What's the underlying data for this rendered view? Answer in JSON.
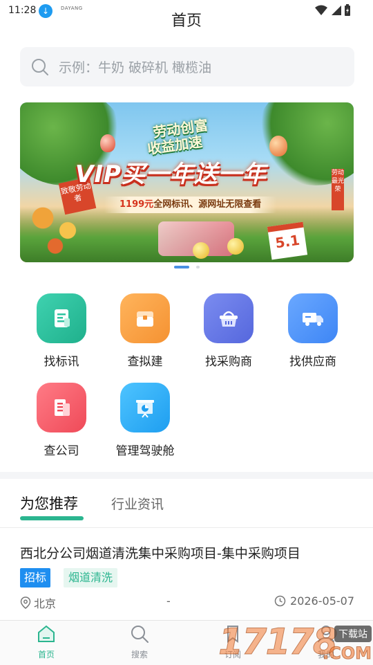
{
  "status_bar": {
    "time": "11:28",
    "download_icon": "download-icon",
    "tiny_logo": "DAYANG"
  },
  "header": {
    "title": "首页"
  },
  "search": {
    "placeholder": "示例：牛奶 破碎机 橄榄油",
    "icon": "search-icon"
  },
  "banner": {
    "slogan_line1": "劳动创富",
    "slogan_line2": "收益加速",
    "headline": "VIP买一年送一年",
    "subline_price": "1199元",
    "subline_rest": "全网标讯、源网址无限查看",
    "tag_left": "致敬劳动者",
    "calendar": "5.1",
    "side_sign": "劳动最光荣",
    "pager": {
      "total": 2,
      "active": 1
    }
  },
  "quick_entries": [
    {
      "label": "找标讯",
      "icon": "document-icon",
      "color_from": "#3fd2b0",
      "color_to": "#1fb08c"
    },
    {
      "label": "查拟建",
      "icon": "inbox-box-icon",
      "color_from": "#ffb45c",
      "color_to": "#f59232"
    },
    {
      "label": "找采购商",
      "icon": "basket-icon",
      "color_from": "#7b8cf0",
      "color_to": "#5567dd"
    },
    {
      "label": "找供应商",
      "icon": "truck-icon",
      "color_from": "#6aa8ff",
      "color_to": "#3e86f5"
    },
    {
      "label": "查公司",
      "icon": "building-icon",
      "color_from": "#ff7b86",
      "color_to": "#ef4a58"
    },
    {
      "label": "管理驾驶舱",
      "icon": "presentation-chart-icon",
      "color_from": "#4ec4ff",
      "color_to": "#1e9ef0"
    }
  ],
  "tabs": {
    "active": "为您推荐",
    "inactive": "行业资讯"
  },
  "recommendation": {
    "title": "西北分公司烟道清洗集中采购项目-集中采购项目",
    "badge_type": "招标",
    "badge_category": "烟道清洗",
    "location": "北京",
    "separator": "-",
    "date": "2026-05-07"
  },
  "bottom_nav": [
    {
      "label": "首页",
      "icon": "home-icon",
      "active": true
    },
    {
      "label": "搜索",
      "icon": "search-icon",
      "active": false
    },
    {
      "label": "订阅",
      "icon": "subscribe-icon",
      "active": false
    },
    {
      "label": "我的",
      "icon": "user-icon",
      "active": false
    }
  ],
  "watermark": {
    "number": "17178",
    "tag": "下载站",
    "suffix": ".COM"
  },
  "colors": {
    "accent": "#2bb58f",
    "badge_blue": "#1e8ef0",
    "pager_active": "#4a90e2"
  }
}
